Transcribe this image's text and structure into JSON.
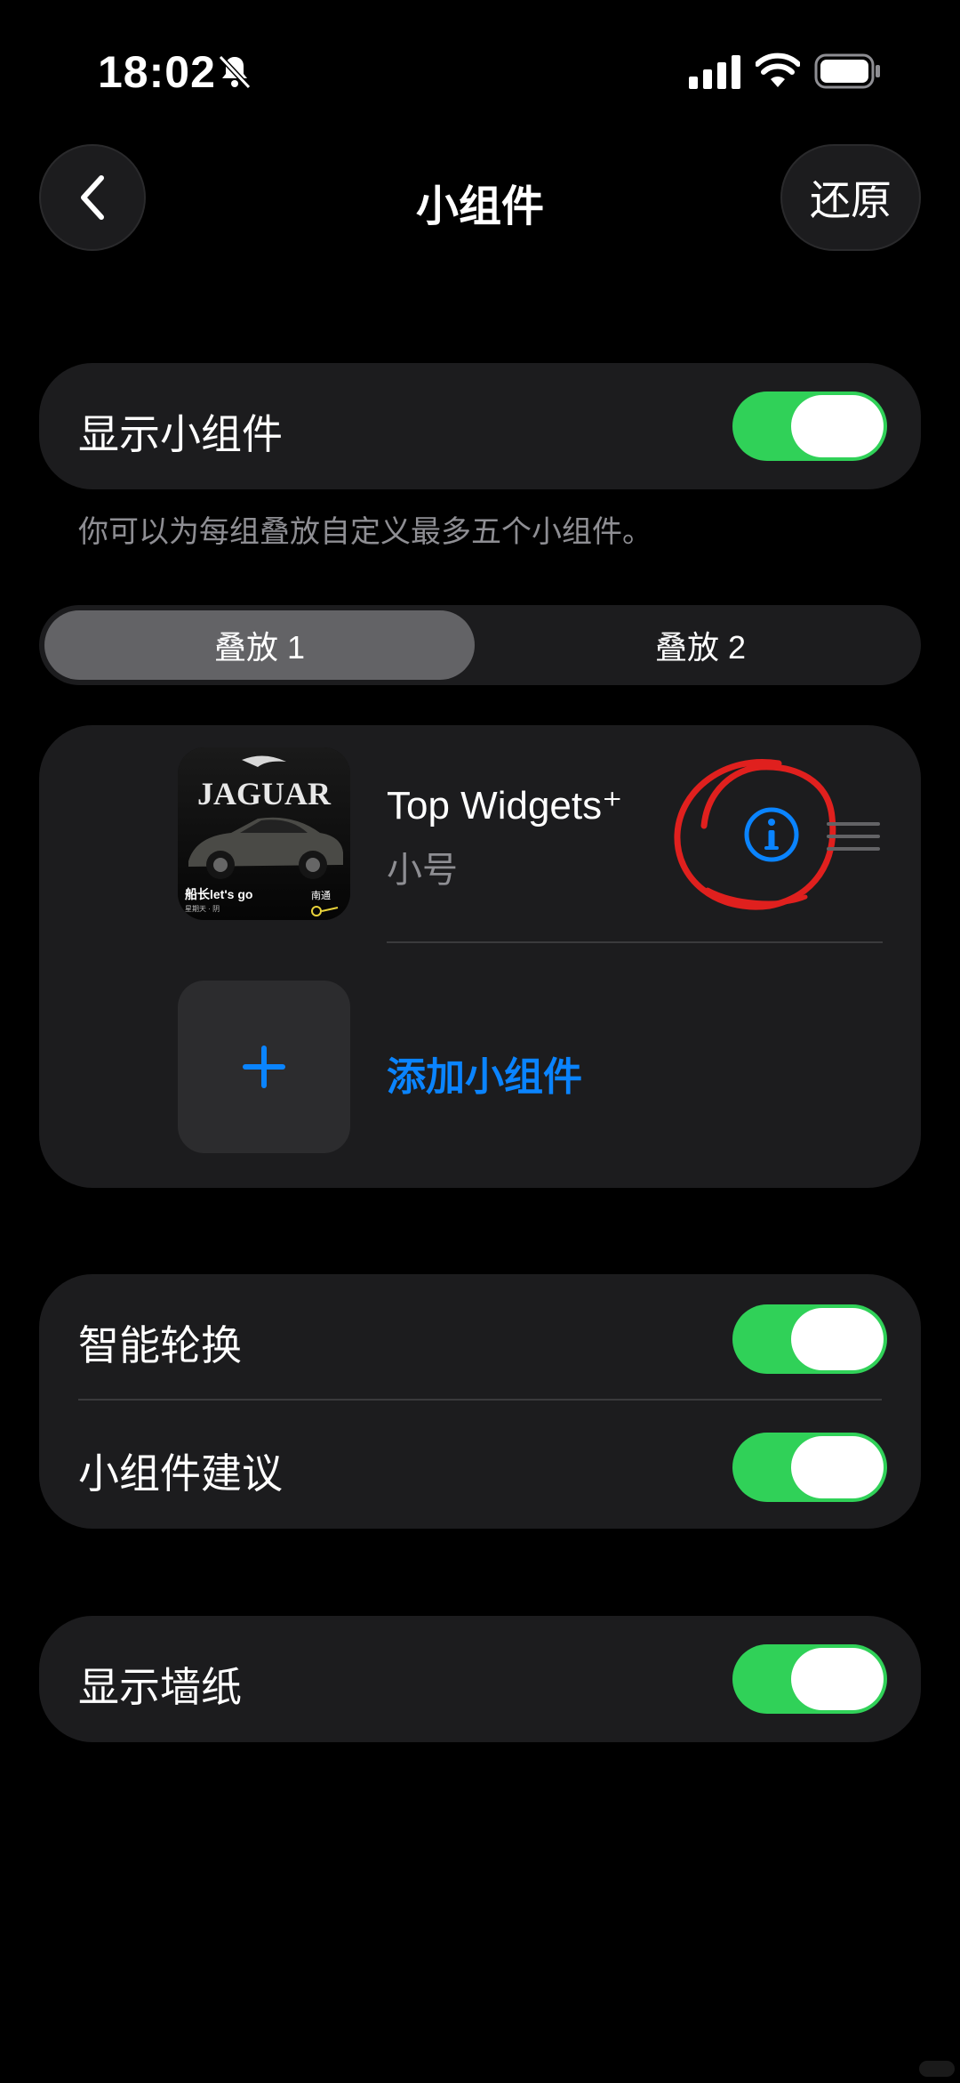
{
  "status_bar": {
    "time": "18:02"
  },
  "nav": {
    "title": "小组件",
    "restore_label": "还原"
  },
  "show_widgets": {
    "label": "显示小组件",
    "on": true
  },
  "hint": "你可以为每组叠放自定义最多五个小组件。",
  "tabs": [
    {
      "label": "叠放 1",
      "active": true
    },
    {
      "label": "叠放 2",
      "active": false
    }
  ],
  "widget": {
    "name": "Top Widgets⁺",
    "size": "小号",
    "thumb_title": "JAGUAR",
    "thumb_caption": "船长let's go",
    "thumb_sub": "星期天 · 阴",
    "thumb_tag": "南通"
  },
  "add_widget_label": "添加小组件",
  "options": [
    {
      "label": "智能轮换",
      "on": true
    },
    {
      "label": "小组件建议",
      "on": true
    }
  ],
  "show_wallpaper": {
    "label": "显示墙纸",
    "on": true
  },
  "colors": {
    "toggle_on": "#30d158",
    "accent": "#0a84ff",
    "annotation": "#e0201e"
  }
}
